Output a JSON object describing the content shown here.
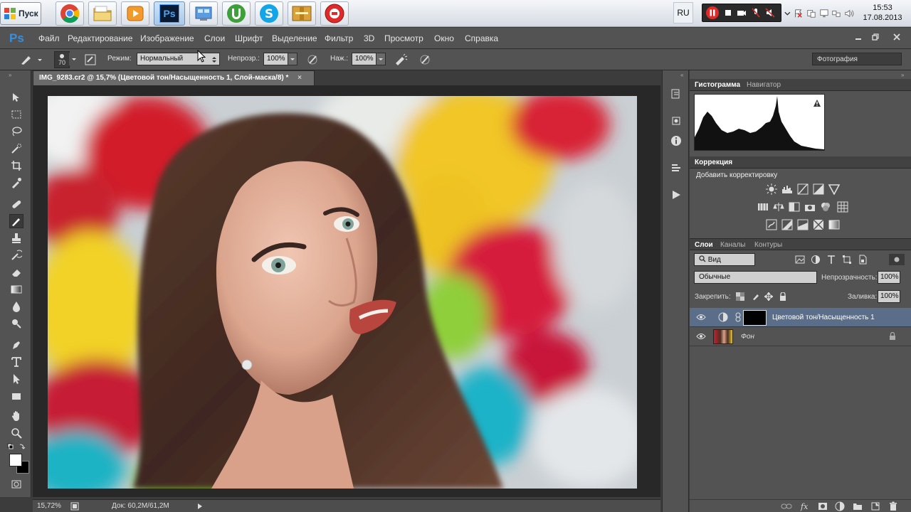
{
  "taskbar": {
    "start_label": "Пуск",
    "apps": [
      {
        "name": "chrome",
        "icon": "chrome-icon"
      },
      {
        "name": "explorer",
        "icon": "folder-icon"
      },
      {
        "name": "player",
        "icon": "media-player-icon"
      },
      {
        "name": "photoshop",
        "label": "Ps",
        "icon": "photoshop-icon"
      },
      {
        "name": "control-panel",
        "icon": "control-panel-icon"
      },
      {
        "name": "utorrent",
        "icon": "utorrent-icon"
      },
      {
        "name": "skype",
        "icon": "skype-icon"
      },
      {
        "name": "archive",
        "icon": "archive-icon"
      },
      {
        "name": "recorder",
        "icon": "record-icon"
      }
    ],
    "language": "RU",
    "clock_time": "15:53",
    "clock_date": "17.08.2013"
  },
  "menu": {
    "logo": "Ps",
    "items": [
      "Файл",
      "Редактирование",
      "Изображение",
      "Слои",
      "Шрифт",
      "Выделение",
      "Фильтр",
      "3D",
      "Просмотр",
      "Окно",
      "Справка"
    ]
  },
  "options": {
    "brush_size": "70",
    "mode_label": "Режим:",
    "mode_value": "Нормальный",
    "opacity_label": "Непрозр.:",
    "opacity_value": "100%",
    "flow_label": "Наж.:",
    "flow_value": "100%",
    "workspace": "Фотография"
  },
  "document": {
    "tab_title": "IMG_9283.cr2 @ 15,7% (Цветовой тон/Насыщенность 1, Слой-маска/8) *",
    "close_glyph": "×",
    "zoom": "15,72%",
    "doc_size": "Док: 60,2M/61,2M"
  },
  "panels": {
    "histogram_tabs": [
      "Гистограмма",
      "Навигатор"
    ],
    "adjust_tab": "Коррекция",
    "adjust_title": "Добавить корректировку",
    "layers_tabs": [
      "Слои",
      "Каналы",
      "Контуры"
    ],
    "filter_kind": "Вид",
    "blend_mode": "Обычные",
    "opacity_label": "Непрозрачность:",
    "opacity_value": "100%",
    "lock_label": "Закрепить:",
    "fill_label": "Заливка:",
    "fill_value": "100%",
    "layers": [
      {
        "name": "Цветовой тон/Насыщенность 1",
        "selected": true
      },
      {
        "name": "Фон",
        "selected": false
      }
    ]
  },
  "colors": {
    "ps_blue": "#3a8edc",
    "panel_bg": "#535353",
    "selected_layer": "#5a6e8a"
  }
}
